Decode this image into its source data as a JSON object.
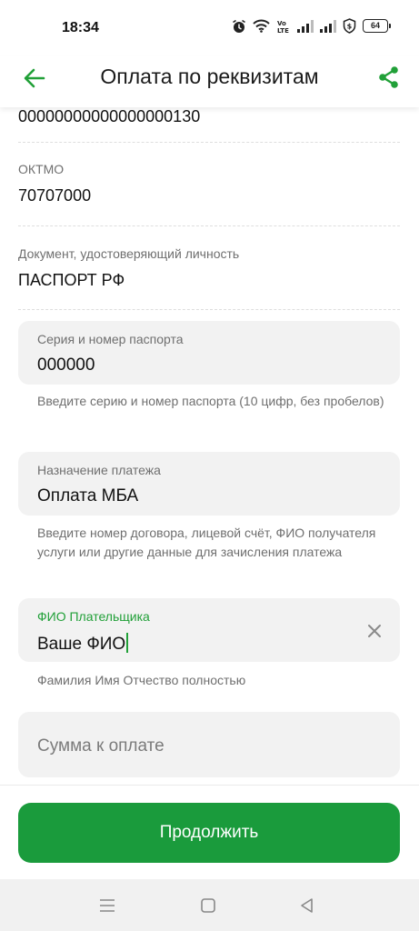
{
  "status": {
    "time": "18:34",
    "battery": "64"
  },
  "header": {
    "title": "Оплата по реквизитам"
  },
  "fields": {
    "account_tail": {
      "value": "00000000000000000130"
    },
    "oktmo": {
      "label": "ОКТМО",
      "value": "70707000"
    },
    "document": {
      "label": "Документ, удостоверяющий личность",
      "value": "ПАСПОРТ РФ"
    }
  },
  "inputs": {
    "passport": {
      "label": "Серия и номер паспорта",
      "value": "000000",
      "hint": "Введите серию и номер паспорта (10 цифр, без пробелов)"
    },
    "purpose": {
      "label": "Назначение платежа",
      "value": "Оплата МБА",
      "hint": "Введите номер договора, лицевой счёт,  ФИО получателя услуги или другие данные для зачисления платежа"
    },
    "payer_name": {
      "label": "ФИО Плательщика",
      "value": "Ваше ФИО",
      "hint": "Фамилия Имя Отчество полностью"
    },
    "amount": {
      "placeholder": "Сумма к оплате"
    }
  },
  "actions": {
    "continue_label": "Продолжить"
  },
  "colors": {
    "accent": "#21a038",
    "button": "#1a9b3c"
  }
}
